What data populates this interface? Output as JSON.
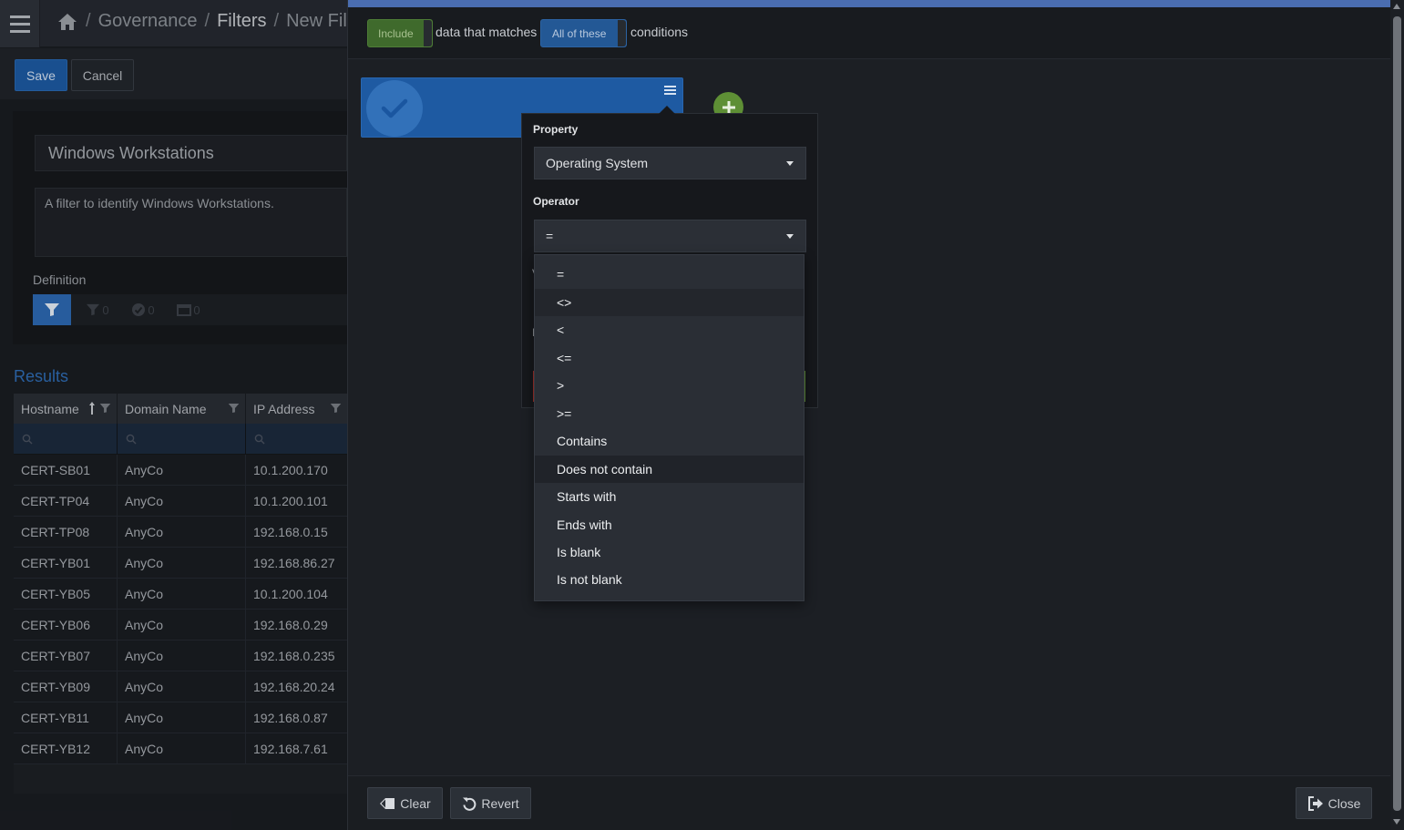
{
  "breadcrumb": {
    "items": [
      "Governance",
      "Filters",
      "New Fil"
    ],
    "separator": "/"
  },
  "actions": {
    "save_label": "Save",
    "cancel_label": "Cancel"
  },
  "filter": {
    "name": "Windows Workstations",
    "description": "A filter to identify Windows Workstations.",
    "definition_label": "Definition",
    "tab_counts": [
      "0",
      "0",
      "0"
    ]
  },
  "results": {
    "title": "Results",
    "columns": [
      "Hostname",
      "Domain Name",
      "IP Address"
    ],
    "rows": [
      [
        "CERT-SB01",
        "AnyCo",
        "10.1.200.170"
      ],
      [
        "CERT-TP04",
        "AnyCo",
        "10.1.200.101"
      ],
      [
        "CERT-TP08",
        "AnyCo",
        "192.168.0.15"
      ],
      [
        "CERT-YB01",
        "AnyCo",
        "192.168.86.27"
      ],
      [
        "CERT-YB05",
        "AnyCo",
        "10.1.200.104"
      ],
      [
        "CERT-YB06",
        "AnyCo",
        "192.168.0.29"
      ],
      [
        "CERT-YB07",
        "AnyCo",
        "192.168.0.235"
      ],
      [
        "CERT-YB09",
        "AnyCo",
        "192.168.20.24"
      ],
      [
        "CERT-YB11",
        "AnyCo",
        "192.168.0.87"
      ],
      [
        "CERT-YB12",
        "AnyCo",
        "192.168.7.61"
      ]
    ]
  },
  "rule_header": {
    "include_label": "Include",
    "text_before": "data that matches",
    "match_label": "All of these",
    "text_after": "conditions"
  },
  "editor": {
    "property_label": "Property",
    "property_value": "Operating System",
    "operator_label": "Operator",
    "operator_value": "=",
    "peek_value_label": "V",
    "peek_label2": "I"
  },
  "operator_options": [
    "=",
    "<>",
    "<",
    "<=",
    ">",
    ">=",
    "Contains",
    "Does not contain",
    "Starts with",
    "Ends with",
    "Is blank",
    "Is not blank"
  ],
  "footer": {
    "clear_label": "Clear",
    "revert_label": "Revert",
    "close_label": "Close"
  },
  "colors": {
    "accent_blue": "#1e5aa2",
    "include_green": "#3f6a2c",
    "add_green": "#5e8f35",
    "panel_bg": "#1c1f24"
  }
}
